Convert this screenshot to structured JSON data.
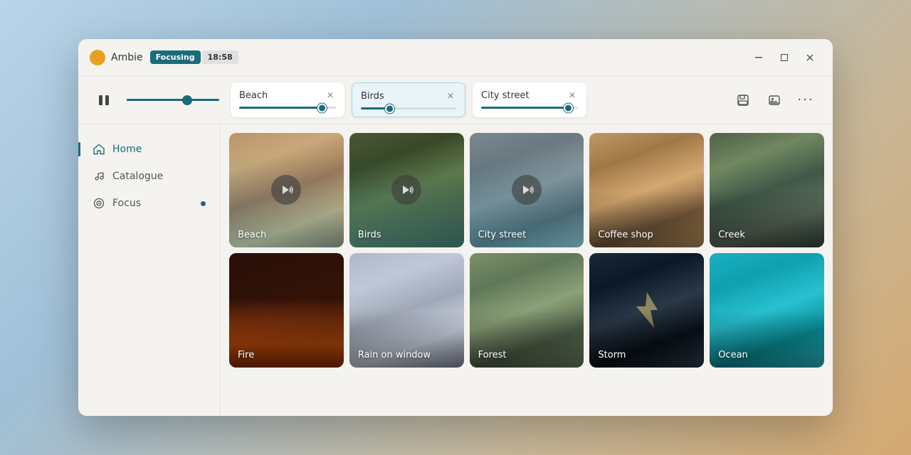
{
  "app": {
    "name": "Ambie",
    "focus_badge": "Focusing",
    "focus_timer": "18:58"
  },
  "window_controls": {
    "minimize": "—",
    "maximize": "□",
    "close": "✕"
  },
  "player": {
    "master_volume_pct": 65,
    "active_sounds": [
      {
        "name": "Beach",
        "volume_pct": 85,
        "active": true
      },
      {
        "name": "Birds",
        "volume_pct": 30,
        "active": true
      },
      {
        "name": "City street",
        "volume_pct": 90,
        "active": true
      }
    ]
  },
  "nav": {
    "items": [
      {
        "id": "home",
        "label": "Home",
        "icon": "⌂",
        "active": true
      },
      {
        "id": "catalogue",
        "label": "Catalogue",
        "icon": "♪",
        "active": false
      },
      {
        "id": "focus",
        "label": "Focus",
        "icon": "◎",
        "active": false,
        "dot": true
      }
    ]
  },
  "grid": {
    "sounds": [
      {
        "id": "beach",
        "label": "Beach",
        "bg": "beach",
        "active": true
      },
      {
        "id": "birds",
        "label": "Birds",
        "bg": "birds",
        "active": true
      },
      {
        "id": "city-street",
        "label": "City street",
        "bg": "city",
        "active": true
      },
      {
        "id": "coffee-shop",
        "label": "Coffee shop",
        "bg": "coffee",
        "active": false
      },
      {
        "id": "creek",
        "label": "Creek",
        "bg": "creek",
        "active": false
      },
      {
        "id": "fire",
        "label": "Fire",
        "bg": "fire",
        "active": false
      },
      {
        "id": "rain-window",
        "label": "Rain on window",
        "bg": "rain",
        "active": false
      },
      {
        "id": "forest",
        "label": "Forest",
        "bg": "forest",
        "active": false
      },
      {
        "id": "storm",
        "label": "Storm",
        "bg": "storm",
        "active": false
      },
      {
        "id": "ocean",
        "label": "Ocean",
        "bg": "ocean",
        "active": false
      }
    ]
  }
}
